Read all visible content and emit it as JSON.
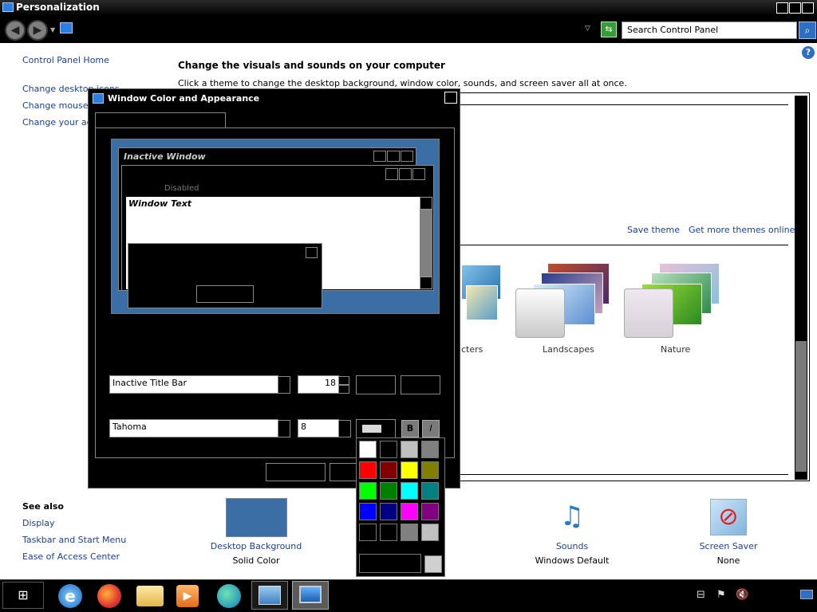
{
  "window": {
    "title": "Personalization"
  },
  "nav": {
    "search_placeholder": "Search Control Panel"
  },
  "sidebar": {
    "home": "Control Panel Home",
    "links": [
      "Change desktop icons",
      "Change mouse pointers",
      "Change your account picture"
    ],
    "see_also_title": "See also",
    "see_also": [
      "Display",
      "Taskbar and Start Menu",
      "Ease of Access Center"
    ]
  },
  "main": {
    "heading": "Change the visuals and sounds on your computer",
    "subheading": "Click a theme to change the desktop background, window color, sounds, and screen saver all at once.",
    "save_theme": "Save theme",
    "get_more": "Get more themes online",
    "themes": [
      {
        "label": "Characters"
      },
      {
        "label": "Landscapes"
      },
      {
        "label": "Nature"
      }
    ]
  },
  "bottom": {
    "items": [
      {
        "label": "Desktop Background",
        "value": "Solid Color"
      },
      {
        "label": "Sounds",
        "value": "Windows Default"
      },
      {
        "label": "Screen Saver",
        "value": "None"
      }
    ],
    "desktop_color": "#3a6ea5"
  },
  "dialog": {
    "title": "Window Color and Appearance",
    "inactive_window": "Inactive Window",
    "disabled": "Disabled",
    "window_text": "Window Text",
    "item_value": "Inactive Title Bar",
    "size_value": "18",
    "font_value": "Tahoma",
    "font_size_value": "8",
    "bold": "B",
    "italic": "I"
  },
  "palette": {
    "colors": [
      "#ffffff",
      "#000000",
      "#c0c0c0",
      "#808080",
      "#ff0000",
      "#800000",
      "#ffff00",
      "#808000",
      "#00ff00",
      "#008000",
      "#00ffff",
      "#008080",
      "#0000ff",
      "#000080",
      "#ff00ff",
      "#800080",
      "#000000",
      "#000000",
      "#808080",
      "#c0c0c0"
    ]
  },
  "taskbar": {
    "apps": [
      "internet-explorer",
      "firefox",
      "file-explorer",
      "media-player",
      "edge",
      "control-panel",
      "display-settings"
    ]
  }
}
